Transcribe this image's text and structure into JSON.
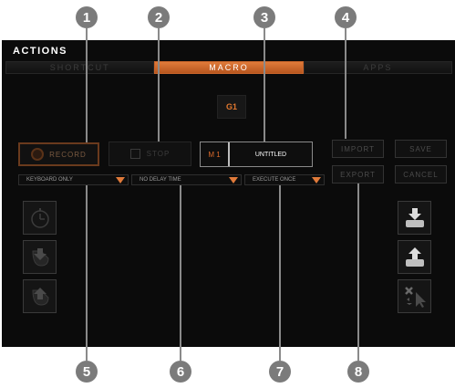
{
  "panel": {
    "title": "ACTIONS"
  },
  "tabs": [
    {
      "label": "SHORTCUT"
    },
    {
      "label": "MACRO"
    },
    {
      "label": "APPS"
    }
  ],
  "slot": {
    "label": "G1"
  },
  "record": {
    "label": "RECORD"
  },
  "stop": {
    "label": "STOP"
  },
  "macro": {
    "id": "M 1",
    "name": "UNTITLED"
  },
  "actions": {
    "import": "IMPORT",
    "save": "SAVE",
    "export": "EXPORT",
    "cancel": "CANCEL"
  },
  "dropdowns": [
    {
      "value": "KEYBOARD ONLY"
    },
    {
      "value": "NO DELAY TIME"
    },
    {
      "value": "EXECUTE ONCE"
    }
  ],
  "callouts": [
    "1",
    "2",
    "3",
    "4",
    "5",
    "6",
    "7",
    "8"
  ],
  "colors": {
    "accent": "#e07a3a",
    "badge": "#7b7b7b",
    "panel": "#0b0b0b"
  }
}
